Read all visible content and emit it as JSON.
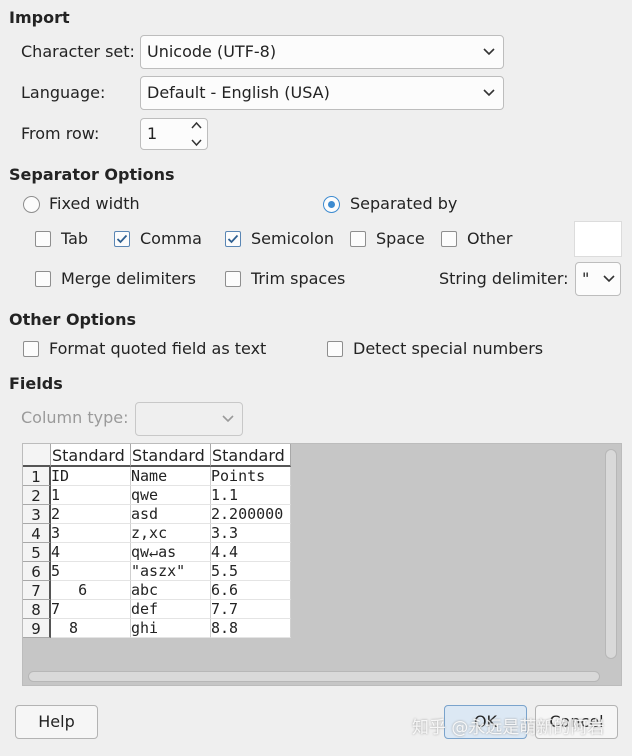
{
  "import": {
    "title": "Import",
    "charset_label": "Character set:",
    "charset_value": "Unicode (UTF-8)",
    "language_label": "Language:",
    "language_value": "Default - English (USA)",
    "fromrow_label": "From row:",
    "fromrow_value": "1"
  },
  "separator": {
    "title": "Separator Options",
    "fixed_width": "Fixed width",
    "separated_by": "Separated by",
    "separated_by_selected": true,
    "tab": "Tab",
    "tab_checked": false,
    "comma": "Comma",
    "comma_checked": true,
    "semicolon": "Semicolon",
    "semicolon_checked": true,
    "space": "Space",
    "space_checked": false,
    "other": "Other",
    "other_checked": false,
    "merge": "Merge delimiters",
    "trim": "Trim spaces",
    "string_delim_label": "String delimiter:",
    "string_delim_value": "\""
  },
  "other_options": {
    "title": "Other Options",
    "format_quoted": "Format quoted field as text",
    "detect_special": "Detect special numbers"
  },
  "fields": {
    "title": "Fields",
    "column_type_label": "Column type:",
    "column_type_value": "",
    "headers": [
      "Standard",
      "Standard",
      "Standard"
    ],
    "rows": [
      [
        "ID",
        "Name",
        "Points"
      ],
      [
        "1",
        "qwe",
        "1.1"
      ],
      [
        "2",
        "asd",
        "2.200000"
      ],
      [
        "3",
        "z,xc",
        "3.3"
      ],
      [
        "4",
        "qw↵as",
        "4.4"
      ],
      [
        "5",
        "\"aszx\"",
        "5.5"
      ],
      [
        "   6",
        "abc",
        "6.6"
      ],
      [
        "7",
        "def",
        "7.7"
      ],
      [
        "  8",
        "ghi",
        "8.8"
      ]
    ],
    "row_numbers": [
      "1",
      "2",
      "3",
      "4",
      "5",
      "6",
      "7",
      "8",
      "9"
    ]
  },
  "buttons": {
    "help": "Help",
    "ok": "OK",
    "cancel": "Cancel"
  },
  "watermark": "知乎 @永远是萌新的阿岩",
  "colors": {
    "background": "#efefef",
    "accent": "#3d8bd0",
    "preview_bg": "#c6c6c6"
  },
  "icons": [
    "chevron-down-icon",
    "spin-up-icon",
    "spin-down-icon",
    "checkmark-icon"
  ]
}
